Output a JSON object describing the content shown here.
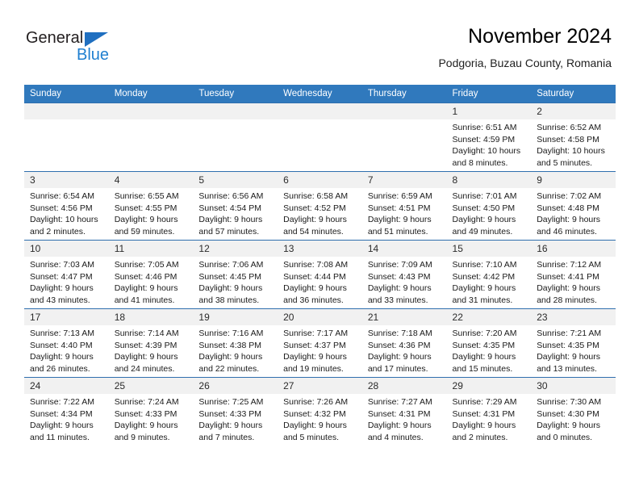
{
  "brand": {
    "name_part1": "General",
    "name_part2": "Blue",
    "triangle_color": "#1f6fc0",
    "blue_color": "#1f7fd0"
  },
  "header": {
    "title": "November 2024",
    "subtitle": "Podgoria, Buzau County, Romania"
  },
  "theme": {
    "header_bg": "#3079bd",
    "daynum_bg": "#f1f1f1",
    "row_border": "#2f6fae"
  },
  "weekdays": [
    "Sunday",
    "Monday",
    "Tuesday",
    "Wednesday",
    "Thursday",
    "Friday",
    "Saturday"
  ],
  "weeks": [
    [
      {
        "day": "",
        "sunrise": "",
        "sunset": "",
        "daylight1": "",
        "daylight2": ""
      },
      {
        "day": "",
        "sunrise": "",
        "sunset": "",
        "daylight1": "",
        "daylight2": ""
      },
      {
        "day": "",
        "sunrise": "",
        "sunset": "",
        "daylight1": "",
        "daylight2": ""
      },
      {
        "day": "",
        "sunrise": "",
        "sunset": "",
        "daylight1": "",
        "daylight2": ""
      },
      {
        "day": "",
        "sunrise": "",
        "sunset": "",
        "daylight1": "",
        "daylight2": ""
      },
      {
        "day": "1",
        "sunrise": "Sunrise: 6:51 AM",
        "sunset": "Sunset: 4:59 PM",
        "daylight1": "Daylight: 10 hours",
        "daylight2": "and 8 minutes."
      },
      {
        "day": "2",
        "sunrise": "Sunrise: 6:52 AM",
        "sunset": "Sunset: 4:58 PM",
        "daylight1": "Daylight: 10 hours",
        "daylight2": "and 5 minutes."
      }
    ],
    [
      {
        "day": "3",
        "sunrise": "Sunrise: 6:54 AM",
        "sunset": "Sunset: 4:56 PM",
        "daylight1": "Daylight: 10 hours",
        "daylight2": "and 2 minutes."
      },
      {
        "day": "4",
        "sunrise": "Sunrise: 6:55 AM",
        "sunset": "Sunset: 4:55 PM",
        "daylight1": "Daylight: 9 hours",
        "daylight2": "and 59 minutes."
      },
      {
        "day": "5",
        "sunrise": "Sunrise: 6:56 AM",
        "sunset": "Sunset: 4:54 PM",
        "daylight1": "Daylight: 9 hours",
        "daylight2": "and 57 minutes."
      },
      {
        "day": "6",
        "sunrise": "Sunrise: 6:58 AM",
        "sunset": "Sunset: 4:52 PM",
        "daylight1": "Daylight: 9 hours",
        "daylight2": "and 54 minutes."
      },
      {
        "day": "7",
        "sunrise": "Sunrise: 6:59 AM",
        "sunset": "Sunset: 4:51 PM",
        "daylight1": "Daylight: 9 hours",
        "daylight2": "and 51 minutes."
      },
      {
        "day": "8",
        "sunrise": "Sunrise: 7:01 AM",
        "sunset": "Sunset: 4:50 PM",
        "daylight1": "Daylight: 9 hours",
        "daylight2": "and 49 minutes."
      },
      {
        "day": "9",
        "sunrise": "Sunrise: 7:02 AM",
        "sunset": "Sunset: 4:48 PM",
        "daylight1": "Daylight: 9 hours",
        "daylight2": "and 46 minutes."
      }
    ],
    [
      {
        "day": "10",
        "sunrise": "Sunrise: 7:03 AM",
        "sunset": "Sunset: 4:47 PM",
        "daylight1": "Daylight: 9 hours",
        "daylight2": "and 43 minutes."
      },
      {
        "day": "11",
        "sunrise": "Sunrise: 7:05 AM",
        "sunset": "Sunset: 4:46 PM",
        "daylight1": "Daylight: 9 hours",
        "daylight2": "and 41 minutes."
      },
      {
        "day": "12",
        "sunrise": "Sunrise: 7:06 AM",
        "sunset": "Sunset: 4:45 PM",
        "daylight1": "Daylight: 9 hours",
        "daylight2": "and 38 minutes."
      },
      {
        "day": "13",
        "sunrise": "Sunrise: 7:08 AM",
        "sunset": "Sunset: 4:44 PM",
        "daylight1": "Daylight: 9 hours",
        "daylight2": "and 36 minutes."
      },
      {
        "day": "14",
        "sunrise": "Sunrise: 7:09 AM",
        "sunset": "Sunset: 4:43 PM",
        "daylight1": "Daylight: 9 hours",
        "daylight2": "and 33 minutes."
      },
      {
        "day": "15",
        "sunrise": "Sunrise: 7:10 AM",
        "sunset": "Sunset: 4:42 PM",
        "daylight1": "Daylight: 9 hours",
        "daylight2": "and 31 minutes."
      },
      {
        "day": "16",
        "sunrise": "Sunrise: 7:12 AM",
        "sunset": "Sunset: 4:41 PM",
        "daylight1": "Daylight: 9 hours",
        "daylight2": "and 28 minutes."
      }
    ],
    [
      {
        "day": "17",
        "sunrise": "Sunrise: 7:13 AM",
        "sunset": "Sunset: 4:40 PM",
        "daylight1": "Daylight: 9 hours",
        "daylight2": "and 26 minutes."
      },
      {
        "day": "18",
        "sunrise": "Sunrise: 7:14 AM",
        "sunset": "Sunset: 4:39 PM",
        "daylight1": "Daylight: 9 hours",
        "daylight2": "and 24 minutes."
      },
      {
        "day": "19",
        "sunrise": "Sunrise: 7:16 AM",
        "sunset": "Sunset: 4:38 PM",
        "daylight1": "Daylight: 9 hours",
        "daylight2": "and 22 minutes."
      },
      {
        "day": "20",
        "sunrise": "Sunrise: 7:17 AM",
        "sunset": "Sunset: 4:37 PM",
        "daylight1": "Daylight: 9 hours",
        "daylight2": "and 19 minutes."
      },
      {
        "day": "21",
        "sunrise": "Sunrise: 7:18 AM",
        "sunset": "Sunset: 4:36 PM",
        "daylight1": "Daylight: 9 hours",
        "daylight2": "and 17 minutes."
      },
      {
        "day": "22",
        "sunrise": "Sunrise: 7:20 AM",
        "sunset": "Sunset: 4:35 PM",
        "daylight1": "Daylight: 9 hours",
        "daylight2": "and 15 minutes."
      },
      {
        "day": "23",
        "sunrise": "Sunrise: 7:21 AM",
        "sunset": "Sunset: 4:35 PM",
        "daylight1": "Daylight: 9 hours",
        "daylight2": "and 13 minutes."
      }
    ],
    [
      {
        "day": "24",
        "sunrise": "Sunrise: 7:22 AM",
        "sunset": "Sunset: 4:34 PM",
        "daylight1": "Daylight: 9 hours",
        "daylight2": "and 11 minutes."
      },
      {
        "day": "25",
        "sunrise": "Sunrise: 7:24 AM",
        "sunset": "Sunset: 4:33 PM",
        "daylight1": "Daylight: 9 hours",
        "daylight2": "and 9 minutes."
      },
      {
        "day": "26",
        "sunrise": "Sunrise: 7:25 AM",
        "sunset": "Sunset: 4:33 PM",
        "daylight1": "Daylight: 9 hours",
        "daylight2": "and 7 minutes."
      },
      {
        "day": "27",
        "sunrise": "Sunrise: 7:26 AM",
        "sunset": "Sunset: 4:32 PM",
        "daylight1": "Daylight: 9 hours",
        "daylight2": "and 5 minutes."
      },
      {
        "day": "28",
        "sunrise": "Sunrise: 7:27 AM",
        "sunset": "Sunset: 4:31 PM",
        "daylight1": "Daylight: 9 hours",
        "daylight2": "and 4 minutes."
      },
      {
        "day": "29",
        "sunrise": "Sunrise: 7:29 AM",
        "sunset": "Sunset: 4:31 PM",
        "daylight1": "Daylight: 9 hours",
        "daylight2": "and 2 minutes."
      },
      {
        "day": "30",
        "sunrise": "Sunrise: 7:30 AM",
        "sunset": "Sunset: 4:30 PM",
        "daylight1": "Daylight: 9 hours",
        "daylight2": "and 0 minutes."
      }
    ]
  ]
}
